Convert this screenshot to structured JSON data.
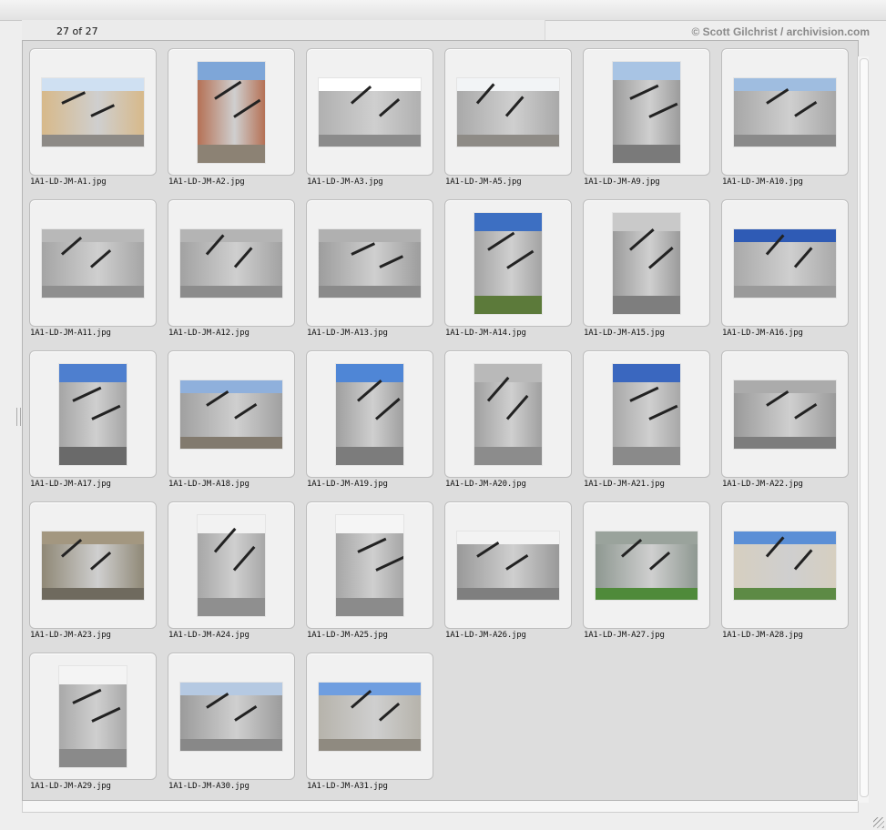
{
  "header": {
    "counter": "27 of 27",
    "credit": "© Scott Gilchrist / archivision.com"
  },
  "thumbnails": [
    {
      "file": "1A1-LD-JM-A1.jpg",
      "orientation": "landscape",
      "sky": "#cfe0f2",
      "building": "#d7b98a",
      "ground": "#8d8a86"
    },
    {
      "file": "1A1-LD-JM-A2.jpg",
      "orientation": "portrait",
      "sky": "#7ea6d8",
      "building": "#b57155",
      "ground": "#8c8274"
    },
    {
      "file": "1A1-LD-JM-A3.jpg",
      "orientation": "landscape",
      "sky": "#ffffff",
      "building": "#b0b0b0",
      "ground": "#8b8b8b"
    },
    {
      "file": "1A1-LD-JM-A5.jpg",
      "orientation": "landscape",
      "sky": "#f2f4f6",
      "building": "#a9a9a9",
      "ground": "#8e8b86"
    },
    {
      "file": "1A1-LD-JM-A9.jpg",
      "orientation": "portrait",
      "sky": "#a8c4e4",
      "building": "#9c9c9c",
      "ground": "#7a7a7a"
    },
    {
      "file": "1A1-LD-JM-A10.jpg",
      "orientation": "landscape",
      "sky": "#9fbde0",
      "building": "#a7a7a7",
      "ground": "#8a8a8a"
    },
    {
      "file": "1A1-LD-JM-A11.jpg",
      "orientation": "landscape",
      "sky": "#b8b8b8",
      "building": "#a5a5a5",
      "ground": "#8f8f8f"
    },
    {
      "file": "1A1-LD-JM-A12.jpg",
      "orientation": "landscape",
      "sky": "#b4b4b4",
      "building": "#a2a2a2",
      "ground": "#8c8c8c"
    },
    {
      "file": "1A1-LD-JM-A13.jpg",
      "orientation": "landscape",
      "sky": "#b0b0b0",
      "building": "#9d9d9d",
      "ground": "#8a8a8a"
    },
    {
      "file": "1A1-LD-JM-A14.jpg",
      "orientation": "portrait",
      "sky": "#3d6fc2",
      "building": "#a3a3a3",
      "ground": "#5c7a3a"
    },
    {
      "file": "1A1-LD-JM-A15.jpg",
      "orientation": "portrait",
      "sky": "#c9c9c9",
      "building": "#9b9b9b",
      "ground": "#7e7e7e"
    },
    {
      "file": "1A1-LD-JM-A16.jpg",
      "orientation": "landscape",
      "sky": "#2f5bb5",
      "building": "#a9a9a9",
      "ground": "#9a9a9a"
    },
    {
      "file": "1A1-LD-JM-A17.jpg",
      "orientation": "portrait",
      "sky": "#4e7fcf",
      "building": "#a5a5a5",
      "ground": "#6a6a6a"
    },
    {
      "file": "1A1-LD-JM-A18.jpg",
      "orientation": "landscape",
      "sky": "#8fb0dc",
      "building": "#a0a0a0",
      "ground": "#827a6e"
    },
    {
      "file": "1A1-LD-JM-A19.jpg",
      "orientation": "portrait",
      "sky": "#4f86d6",
      "building": "#9f9f9f",
      "ground": "#7c7c7c"
    },
    {
      "file": "1A1-LD-JM-A20.jpg",
      "orientation": "portrait",
      "sky": "#b9b9b9",
      "building": "#a0a0a0",
      "ground": "#8c8c8c"
    },
    {
      "file": "1A1-LD-JM-A21.jpg",
      "orientation": "portrait",
      "sky": "#3a67bf",
      "building": "#a8a8a8",
      "ground": "#8a8a8a"
    },
    {
      "file": "1A1-LD-JM-A22.jpg",
      "orientation": "landscape",
      "sky": "#ababab",
      "building": "#9a9a9a",
      "ground": "#7d7d7d"
    },
    {
      "file": "1A1-LD-JM-A23.jpg",
      "orientation": "landscape",
      "sky": "#a39780",
      "building": "#8f8876",
      "ground": "#6f6a5e"
    },
    {
      "file": "1A1-LD-JM-A24.jpg",
      "orientation": "portrait",
      "sky": "#f2f2f2",
      "building": "#a7a7a7",
      "ground": "#8f8f8f"
    },
    {
      "file": "1A1-LD-JM-A25.jpg",
      "orientation": "portrait",
      "sky": "#f5f5f5",
      "building": "#a6a6a6",
      "ground": "#8b8b8b"
    },
    {
      "file": "1A1-LD-JM-A26.jpg",
      "orientation": "landscape",
      "sky": "#f3f3f3",
      "building": "#999999",
      "ground": "#7f7f7f"
    },
    {
      "file": "1A1-LD-JM-A27.jpg",
      "orientation": "landscape",
      "sky": "#9aa39c",
      "building": "#8e9891",
      "ground": "#4f8a3a"
    },
    {
      "file": "1A1-LD-JM-A28.jpg",
      "orientation": "landscape",
      "sky": "#5b8fd6",
      "building": "#d6cfc0",
      "ground": "#5d8a45"
    },
    {
      "file": "1A1-LD-JM-A29.jpg",
      "orientation": "portrait",
      "sky": "#f4f4f4",
      "building": "#a9a9a9",
      "ground": "#8a8a8a"
    },
    {
      "file": "1A1-LD-JM-A30.jpg",
      "orientation": "landscape",
      "sky": "#b5c9e2",
      "building": "#9b9b9b",
      "ground": "#888888"
    },
    {
      "file": "1A1-LD-JM-A31.jpg",
      "orientation": "landscape",
      "sky": "#6f9ee0",
      "building": "#b6b3ab",
      "ground": "#8f8a80"
    }
  ]
}
